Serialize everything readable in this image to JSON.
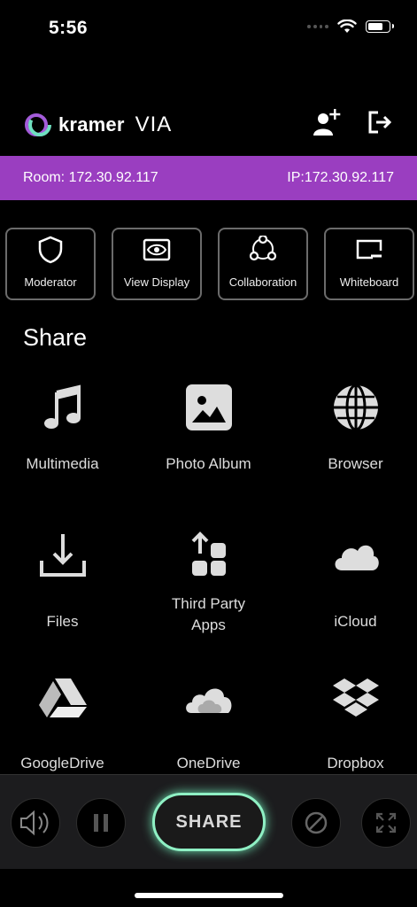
{
  "status_bar": {
    "time": "5:56"
  },
  "header": {
    "logo_text": "kramer",
    "logo_suffix": "VIA",
    "icons": [
      "add-user-icon",
      "logout-icon"
    ]
  },
  "room_bar": {
    "room": "Room:  172.30.92.117",
    "ip": "IP:172.30.92.117",
    "color": "#9a3ec0"
  },
  "tools": [
    {
      "label": "Moderator",
      "icon": "shield-icon"
    },
    {
      "label": "View Display",
      "icon": "eye-icon"
    },
    {
      "label": "Collaboration",
      "icon": "collaboration-icon"
    },
    {
      "label": "Whiteboard",
      "icon": "whiteboard-icon"
    }
  ],
  "share": {
    "heading": "Share",
    "items": [
      {
        "label": "Multimedia",
        "icon": "music-note-icon"
      },
      {
        "label": "Photo Album",
        "icon": "photo-icon"
      },
      {
        "label": "Browser",
        "icon": "globe-icon"
      },
      {
        "label": "Files",
        "icon": "download-icon"
      },
      {
        "label": "Third Party",
        "label2": "Apps",
        "icon": "apps-icon"
      },
      {
        "label": "iCloud",
        "icon": "cloud-icon"
      },
      {
        "label": "GoogleDrive",
        "icon": "google-drive-icon"
      },
      {
        "label": "OneDrive",
        "icon": "onedrive-icon"
      },
      {
        "label": "Dropbox",
        "icon": "dropbox-icon"
      }
    ]
  },
  "bottom_bar": {
    "share_label": "SHARE",
    "accent": "#8ff0c4",
    "buttons": [
      "volume-icon",
      "pause-icon",
      "share-button",
      "block-icon",
      "fullscreen-icon"
    ]
  }
}
